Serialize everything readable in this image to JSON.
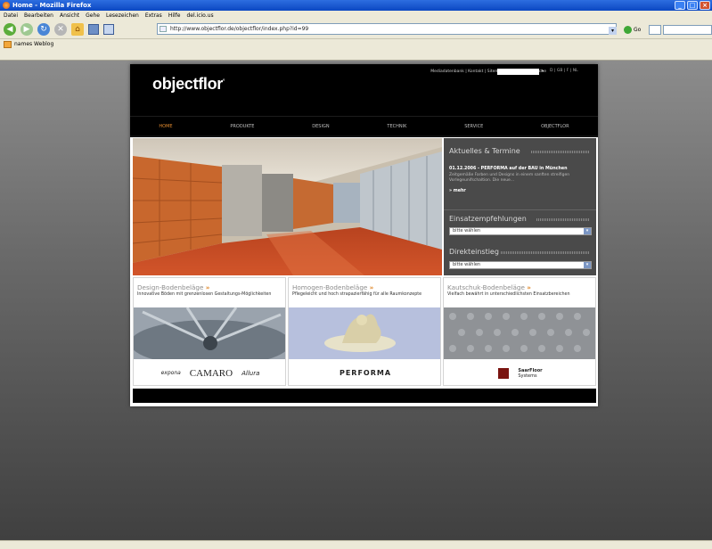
{
  "browser": {
    "title": "Home - Mozilla Firefox",
    "menu": [
      "Datei",
      "Bearbeiten",
      "Ansicht",
      "Gehe",
      "Lesezeichen",
      "Extras",
      "Hilfe",
      "del.icio.us"
    ],
    "url": "http://www.objectflor.de/objectflor/index.php?id=99",
    "go_label": "Go",
    "bookmark": "names Weblog"
  },
  "site": {
    "logo": "objectflor",
    "logo_mark": "°",
    "top_links": "Mediadatenbank | Kontakt | Sitemap | Impressum | Suche",
    "search_go": "»",
    "lang_links": "D | GB | F | NL",
    "nav": [
      "HOME",
      "PRODUKTE",
      "DESIGN",
      "TECHNIK",
      "SERVICE",
      "OBJECTFLOR"
    ],
    "sidebar": {
      "news_title": "Aktuelles & Termine",
      "news_headline": "01.12.2006 - PERFORMA auf der BAU in München",
      "news_text": "Zeitgemäße Farben und Designs in einem sanften streifigen Vorlegeunifschaltion. Die neue...",
      "news_more": "» mehr",
      "recommend_title": "Einsatzempfehlungen",
      "recommend_select": "bitte wählen",
      "direct_title": "Direkteinstieg",
      "direct_select": "bitte wählen"
    },
    "products": [
      {
        "title": "Design-Bodenbeläge",
        "desc": "Innovative Böden mit grenzenlosen Gestaltungs-Möglichkeiten",
        "brands": [
          "expona",
          "CAMARO",
          "Allura"
        ]
      },
      {
        "title": "Homogen-Bodenbeläge",
        "desc": "Pflegeleicht und hoch strapazierfähig für alle Raumkonzepte",
        "brands": [
          "PERFORMA"
        ]
      },
      {
        "title": "Kautschuk-Bodenbeläge",
        "desc": "Vielfach bewährt in unterschiedlichsten Einsatzbereichen",
        "brands": [
          "SaarFloor",
          "Systems"
        ]
      }
    ],
    "product_arrow": "»"
  },
  "colors": {
    "accent": "#e08a2e",
    "header_bg": "#000000",
    "sidebar_bg": "#4a4a4a"
  }
}
